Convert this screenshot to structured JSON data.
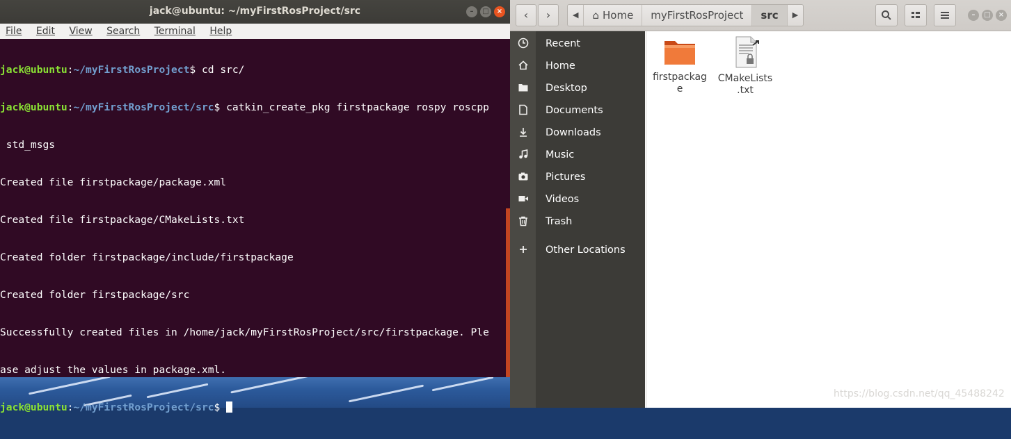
{
  "terminal": {
    "title": "jack@ubuntu: ~/myFirstRosProject/src",
    "menu": [
      "File",
      "Edit",
      "View",
      "Search",
      "Terminal",
      "Help"
    ],
    "lines": [
      {
        "user": "jack@ubuntu",
        "path": "~/myFirstRosProject",
        "cmd": "$ cd src/"
      },
      {
        "user": "jack@ubuntu",
        "path": "~/myFirstRosProject/src",
        "cmd": "$ catkin_create_pkg firstpackage rospy roscpp"
      },
      {
        "text": " std_msgs"
      },
      {
        "text": "Created file firstpackage/package.xml"
      },
      {
        "text": "Created file firstpackage/CMakeLists.txt"
      },
      {
        "text": "Created folder firstpackage/include/firstpackage"
      },
      {
        "text": "Created folder firstpackage/src"
      },
      {
        "text": "Successfully created files in /home/jack/myFirstRosProject/src/firstpackage. Ple"
      },
      {
        "text": "ase adjust the values in package.xml."
      },
      {
        "user": "jack@ubuntu",
        "path": "~/myFirstRosProject/src",
        "cmd": "$ ",
        "cursor": true
      }
    ]
  },
  "files": {
    "breadcrumbs": [
      "Home",
      "myFirstRosProject",
      "src"
    ],
    "sidebar": [
      {
        "label": "Recent",
        "icon": "clock-icon"
      },
      {
        "label": "Home",
        "icon": "home-icon"
      },
      {
        "label": "Desktop",
        "icon": "folder-icon"
      },
      {
        "label": "Documents",
        "icon": "document-icon"
      },
      {
        "label": "Downloads",
        "icon": "download-icon"
      },
      {
        "label": "Music",
        "icon": "music-icon"
      },
      {
        "label": "Pictures",
        "icon": "camera-icon"
      },
      {
        "label": "Videos",
        "icon": "video-icon"
      },
      {
        "label": "Trash",
        "icon": "trash-icon"
      },
      {
        "label": "Other Locations",
        "icon": "plus-icon"
      }
    ],
    "items": [
      {
        "name_line1": "firstpackag",
        "name_line2": "e",
        "type": "folder"
      },
      {
        "name_line1": "CMakeLists",
        "name_line2": ".txt",
        "type": "text-file-locked"
      }
    ]
  },
  "watermark": "https://blog.csdn.net/qq_45488242",
  "colors": {
    "terminal_bg": "#300a24",
    "prompt_user": "#8ae234",
    "prompt_path": "#729fcf",
    "accent": "#e95420",
    "sidebar_bg": "#3c3b37"
  }
}
